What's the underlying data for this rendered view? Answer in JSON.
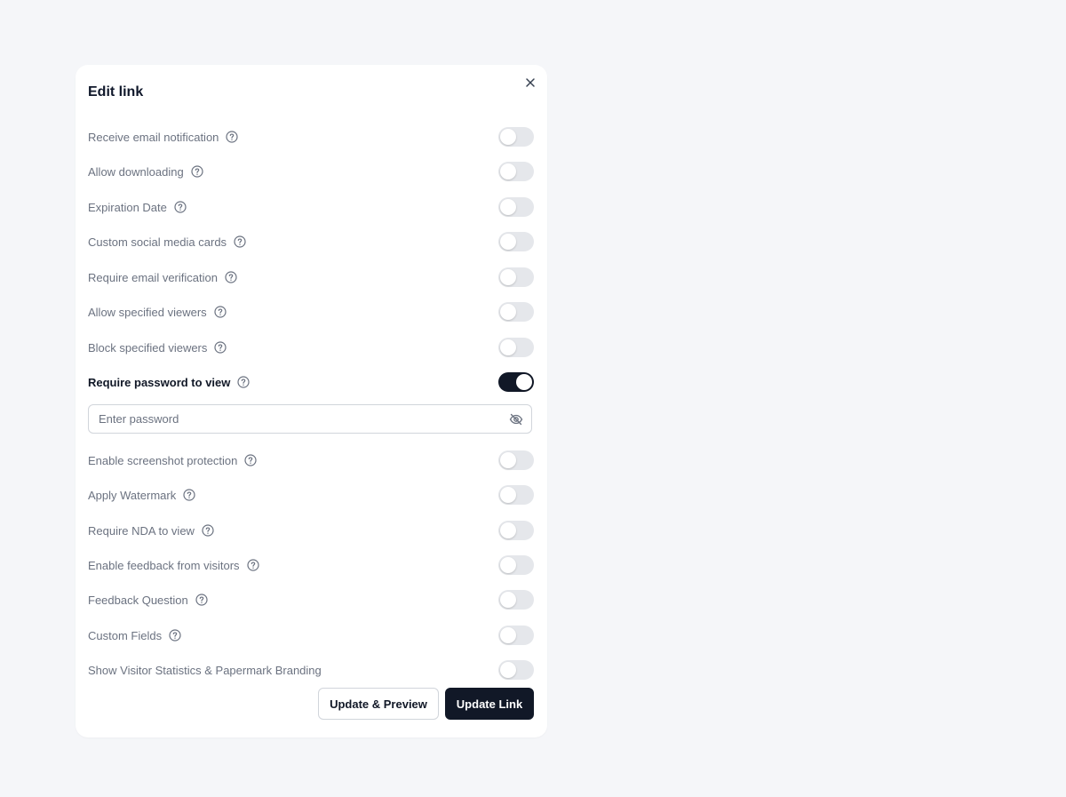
{
  "dialog": {
    "title": "Edit link",
    "close_icon": "close-icon"
  },
  "settings": [
    {
      "label": "Receive email notification",
      "enabled": false,
      "help": true
    },
    {
      "label": "Allow downloading",
      "enabled": false,
      "help": true
    },
    {
      "label": "Expiration Date",
      "enabled": false,
      "help": true
    },
    {
      "label": "Custom social media cards",
      "enabled": false,
      "help": true
    },
    {
      "label": "Require email verification",
      "enabled": false,
      "help": true
    },
    {
      "label": "Allow specified viewers",
      "enabled": false,
      "help": true
    },
    {
      "label": "Block specified viewers",
      "enabled": false,
      "help": true
    },
    {
      "label": "Require password to view",
      "enabled": true,
      "help": true
    },
    {
      "label": "Enable screenshot protection",
      "enabled": false,
      "help": true
    },
    {
      "label": "Apply Watermark",
      "enabled": false,
      "help": true
    },
    {
      "label": "Require NDA to view",
      "enabled": false,
      "help": true
    },
    {
      "label": "Enable feedback from visitors",
      "enabled": false,
      "help": true
    },
    {
      "label": "Feedback Question",
      "enabled": false,
      "help": true
    },
    {
      "label": "Custom Fields",
      "enabled": false,
      "help": true
    },
    {
      "label": "Show Visitor Statistics & Papermark Branding",
      "enabled": false,
      "help": false
    }
  ],
  "password": {
    "value": "",
    "placeholder": "Enter password",
    "visibility_icon": "eye-off-icon"
  },
  "actions": {
    "preview_label": "Update & Preview",
    "update_label": "Update Link"
  },
  "colors": {
    "toggle_on": "#111827",
    "toggle_off": "#e5e7eb",
    "primary_button": "#111827"
  }
}
